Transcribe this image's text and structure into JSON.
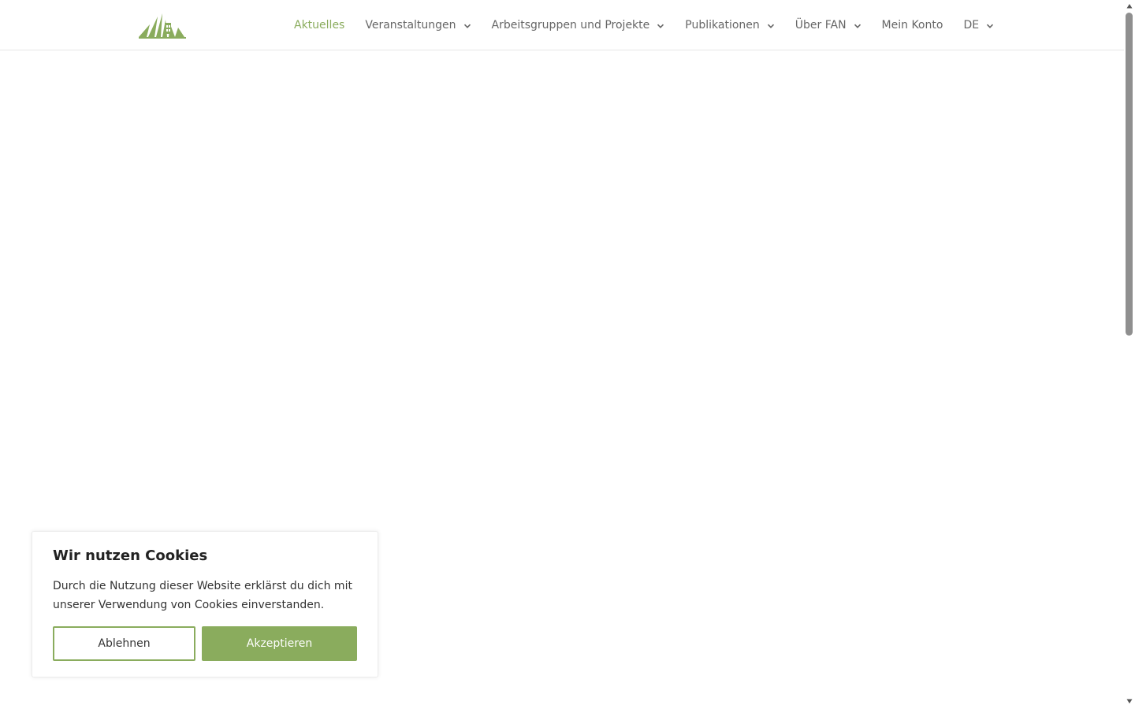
{
  "header": {
    "logo_icon": "fan-mountain-logo-icon",
    "nav": [
      {
        "label": "Aktuelles",
        "active": true,
        "has_dropdown": false
      },
      {
        "label": "Veranstaltungen",
        "active": false,
        "has_dropdown": true
      },
      {
        "label": "Arbeitsgruppen und Projekte",
        "active": false,
        "has_dropdown": true
      },
      {
        "label": "Publikationen",
        "active": false,
        "has_dropdown": true
      },
      {
        "label": "Über FAN",
        "active": false,
        "has_dropdown": true
      },
      {
        "label": "Mein Konto",
        "active": false,
        "has_dropdown": false
      },
      {
        "label": "DE",
        "active": false,
        "has_dropdown": true
      }
    ]
  },
  "cookie_banner": {
    "title": "Wir nutzen Cookies",
    "text": "Durch die Nutzung dieser Website erklärst du dich mit unserer Verwendung von Cookies einverstanden.",
    "decline_label": "Ablehnen",
    "accept_label": "Akzeptieren"
  },
  "colors": {
    "accent": "#8aac5d",
    "nav_text": "#666666",
    "body_text": "#333333",
    "heading_text": "#222222"
  }
}
